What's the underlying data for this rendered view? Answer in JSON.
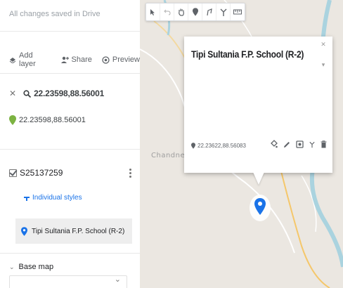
{
  "panel": {
    "status": "All changes saved in Drive",
    "toolbar": {
      "add_layer": "Add layer",
      "share": "Share",
      "preview": "Preview"
    },
    "search": {
      "query": "22.23598,88.56001"
    },
    "result_coords": "22.23598,88.56001",
    "layer": {
      "title": "S25137259",
      "styles_link": "Individual styles"
    },
    "place_item": "Tipi Sultania F.P. School (R-2)",
    "base_map": "Base map"
  },
  "map": {
    "labels": {
      "chandnes": "Chandnes"
    },
    "card": {
      "title": "Tipi Sultania F.P. School (R-2)",
      "coords": "22.23622,88.56083"
    },
    "colors": {
      "river": "#aad3df",
      "road": "#f5c76a",
      "land": "#ebe7e1",
      "marker": "#1a73e8",
      "green_pin": "#7cb342"
    }
  },
  "icons": {
    "toolbar": [
      "pointer-icon",
      "undo-icon",
      "hand-icon",
      "marker-icon",
      "polyline-icon",
      "directions-icon",
      "ruler-icon"
    ],
    "card_actions": [
      "paint-bucket-icon",
      "pencil-icon",
      "camera-icon",
      "directions-icon",
      "trash-icon"
    ]
  }
}
